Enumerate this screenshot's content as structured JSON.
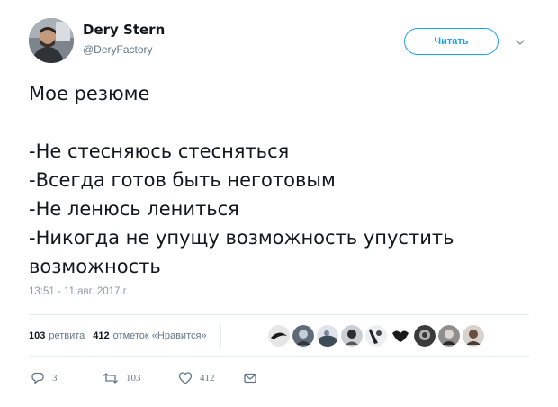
{
  "user": {
    "display_name": "Dery Stern",
    "handle": "@DeryFactory"
  },
  "follow_button": {
    "label": "Читать"
  },
  "tweet": {
    "lines": [
      "Мое резюме",
      "",
      "-Не стесняюсь стесняться",
      "-Всегда готов быть неготовым",
      "-Не ленюсь лениться",
      "-Никогда не упущу возможность упустить",
      "возможность"
    ],
    "timestamp": "13:51 - 11 авг. 2017 г."
  },
  "stats": {
    "retweets_count": "103",
    "retweets_label": "ретвита",
    "likes_count": "412",
    "likes_label": "отметок «Нравится»"
  },
  "actions": {
    "reply_count": "3",
    "retweet_count": "103",
    "like_count": "412"
  },
  "icons": {
    "reply": "reply-icon",
    "retweet": "retweet-icon",
    "like": "heart-icon",
    "dm": "envelope-icon",
    "caret": "chevron-down-icon"
  },
  "colors": {
    "accent": "#1da1f2",
    "secondary_text": "#657786",
    "divider": "#e6ecf0"
  }
}
